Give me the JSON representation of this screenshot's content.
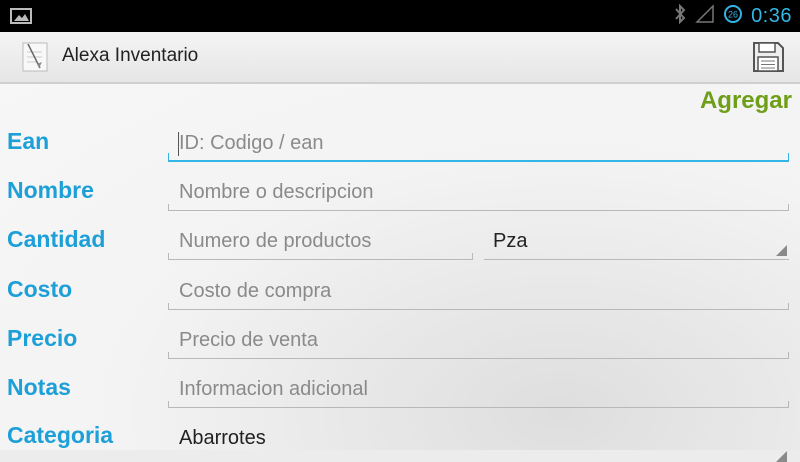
{
  "status_bar": {
    "time": "0:36",
    "battery_level": "26",
    "icons": [
      "gallery-icon",
      "bluetooth-icon",
      "signal-icon",
      "battery-icon"
    ]
  },
  "action_bar": {
    "title": "Alexa Inventario",
    "app_icon": "notepad-icon",
    "save_icon": "floppy-disk-icon"
  },
  "form": {
    "submit_label": "Agregar",
    "fields": {
      "ean": {
        "label": "Ean",
        "placeholder": "ID: Codigo / ean"
      },
      "nombre": {
        "label": "Nombre",
        "placeholder": "Nombre o descripcion"
      },
      "cantidad": {
        "label": "Cantidad",
        "placeholder": "Numero de productos",
        "unit_value": "Pza"
      },
      "costo": {
        "label": "Costo",
        "placeholder": "Costo de compra"
      },
      "precio": {
        "label": "Precio",
        "placeholder": "Precio de venta"
      },
      "notas": {
        "label": "Notas",
        "placeholder": "Informacion adicional"
      },
      "categoria": {
        "label": "Categoria",
        "value": "Abarrotes"
      }
    }
  },
  "colors": {
    "label": "#1d9fd8",
    "accent": "#33b5e5",
    "agregar": "#6f9e19",
    "status_bar": "#000000"
  }
}
